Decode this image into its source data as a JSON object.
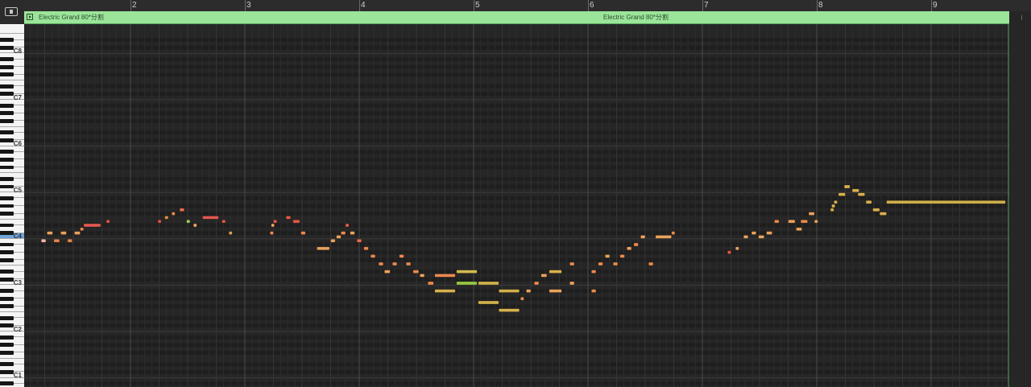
{
  "ruler": {
    "bars": [
      "2",
      "3",
      "4",
      "5",
      "6",
      "7",
      "8",
      "9"
    ]
  },
  "region": {
    "name": "Electric Grand 80*分割",
    "name_repeat": "Electric Grand 80*分割",
    "color": "#9be59a"
  },
  "keyboard": {
    "c_labels": [
      "C8",
      "C7",
      "C6",
      "C5",
      "C4",
      "C3",
      "C2",
      "C1"
    ],
    "highlight_color": "#6fa4d8"
  },
  "notes": [
    {
      "bar": 1.22,
      "len": 0.04,
      "midi": 59,
      "color": "#ffb6a8"
    },
    {
      "bar": 1.27,
      "len": 0.05,
      "midi": 61,
      "color": "#e9a25c"
    },
    {
      "bar": 1.33,
      "len": 0.05,
      "midi": 59,
      "color": "#e5854d"
    },
    {
      "bar": 1.39,
      "len": 0.05,
      "midi": 61,
      "color": "#e9a25c"
    },
    {
      "bar": 1.45,
      "len": 0.04,
      "midi": 59,
      "color": "#e5854d"
    },
    {
      "bar": 1.51,
      "len": 0.05,
      "midi": 61,
      "color": "#e9a25c"
    },
    {
      "bar": 1.56,
      "len": 0.03,
      "midi": 62,
      "color": "#e98a4f"
    },
    {
      "bar": 1.59,
      "len": 0.15,
      "midi": 63,
      "color": "#e0584f"
    },
    {
      "bar": 1.79,
      "len": 0.02,
      "midi": 64,
      "color": "#e05a45"
    },
    {
      "bar": 2.24,
      "len": 0.02,
      "midi": 64,
      "color": "#e05a45"
    },
    {
      "bar": 2.3,
      "len": 0.03,
      "midi": 65,
      "color": "#e98a4f"
    },
    {
      "bar": 2.36,
      "len": 0.03,
      "midi": 66,
      "color": "#e98a4f"
    },
    {
      "bar": 2.43,
      "len": 0.04,
      "midi": 67,
      "color": "#e86f4d"
    },
    {
      "bar": 2.49,
      "len": 0.03,
      "midi": 64,
      "color": "#9fd160"
    },
    {
      "bar": 2.55,
      "len": 0.03,
      "midi": 63,
      "color": "#e9a25c"
    },
    {
      "bar": 2.63,
      "len": 0.14,
      "midi": 65,
      "color": "#e0584f"
    },
    {
      "bar": 2.8,
      "len": 0.03,
      "midi": 64,
      "color": "#e05a45"
    },
    {
      "bar": 2.86,
      "len": 0.03,
      "midi": 61,
      "color": "#d9a24c"
    },
    {
      "bar": 3.22,
      "len": 0.03,
      "midi": 61,
      "color": "#e98a4f"
    },
    {
      "bar": 3.23,
      "len": 0.02,
      "midi": 63,
      "color": "#e9a25c"
    },
    {
      "bar": 3.25,
      "len": 0.03,
      "midi": 64,
      "color": "#e05a45"
    },
    {
      "bar": 3.36,
      "len": 0.04,
      "midi": 65,
      "color": "#e05a45"
    },
    {
      "bar": 3.42,
      "len": 0.06,
      "midi": 64,
      "color": "#e05a45"
    },
    {
      "bar": 3.49,
      "len": 0.04,
      "midi": 61,
      "color": "#e98a4f"
    },
    {
      "bar": 3.63,
      "len": 0.11,
      "midi": 57,
      "color": "#e9a25c"
    },
    {
      "bar": 3.75,
      "len": 0.04,
      "midi": 59,
      "color": "#e9a25c"
    },
    {
      "bar": 3.8,
      "len": 0.04,
      "midi": 60,
      "color": "#e9a25c"
    },
    {
      "bar": 3.84,
      "len": 0.04,
      "midi": 61,
      "color": "#e98a4f"
    },
    {
      "bar": 3.88,
      "len": 0.03,
      "midi": 63,
      "color": "#e0584f"
    },
    {
      "bar": 3.92,
      "len": 0.04,
      "midi": 61,
      "color": "#e9a25c"
    },
    {
      "bar": 3.98,
      "len": 0.04,
      "midi": 59,
      "color": "#e86f4d"
    },
    {
      "bar": 4.04,
      "len": 0.04,
      "midi": 57,
      "color": "#e98a4f"
    },
    {
      "bar": 4.1,
      "len": 0.04,
      "midi": 55,
      "color": "#e98a4f"
    },
    {
      "bar": 4.17,
      "len": 0.04,
      "midi": 53,
      "color": "#e98a4f"
    },
    {
      "bar": 4.22,
      "len": 0.05,
      "midi": 51,
      "color": "#e9a25c"
    },
    {
      "bar": 4.29,
      "len": 0.04,
      "midi": 53,
      "color": "#e98a4f"
    },
    {
      "bar": 4.35,
      "len": 0.04,
      "midi": 55,
      "color": "#e98a4f"
    },
    {
      "bar": 4.41,
      "len": 0.04,
      "midi": 53,
      "color": "#e98a4f"
    },
    {
      "bar": 4.47,
      "len": 0.05,
      "midi": 51,
      "color": "#e98a4f"
    },
    {
      "bar": 4.53,
      "len": 0.04,
      "midi": 50,
      "color": "#e9a25c"
    },
    {
      "bar": 4.6,
      "len": 0.05,
      "midi": 48,
      "color": "#e98a4f"
    },
    {
      "bar": 4.66,
      "len": 0.18,
      "midi": 46,
      "color": "#d7b04e"
    },
    {
      "bar": 4.66,
      "len": 0.18,
      "midi": 50,
      "color": "#e98a4f"
    },
    {
      "bar": 4.85,
      "len": 0.18,
      "midi": 51,
      "color": "#d2bb52"
    },
    {
      "bar": 4.85,
      "len": 0.18,
      "midi": 48,
      "color": "#98c83f"
    },
    {
      "bar": 5.04,
      "len": 0.18,
      "midi": 48,
      "color": "#d0b04a"
    },
    {
      "bar": 5.04,
      "len": 0.18,
      "midi": 43,
      "color": "#d0b04a"
    },
    {
      "bar": 5.22,
      "len": 0.18,
      "midi": 46,
      "color": "#d0b04a"
    },
    {
      "bar": 5.22,
      "len": 0.18,
      "midi": 41,
      "color": "#d7b04e"
    },
    {
      "bar": 5.41,
      "len": 0.03,
      "midi": 44,
      "color": "#e98a4f"
    },
    {
      "bar": 5.46,
      "len": 0.04,
      "midi": 46,
      "color": "#e9a25c"
    },
    {
      "bar": 5.53,
      "len": 0.04,
      "midi": 48,
      "color": "#e98a4f"
    },
    {
      "bar": 5.59,
      "len": 0.05,
      "midi": 50,
      "color": "#e9a25c"
    },
    {
      "bar": 5.66,
      "len": 0.11,
      "midi": 51,
      "color": "#d7b04e"
    },
    {
      "bar": 5.66,
      "len": 0.11,
      "midi": 46,
      "color": "#e9a25c"
    },
    {
      "bar": 5.84,
      "len": 0.04,
      "midi": 48,
      "color": "#e9a25c"
    },
    {
      "bar": 5.84,
      "len": 0.04,
      "midi": 53,
      "color": "#e98a4f"
    },
    {
      "bar": 6.03,
      "len": 0.04,
      "midi": 51,
      "color": "#e98a4f"
    },
    {
      "bar": 6.03,
      "len": 0.04,
      "midi": 46,
      "color": "#e98a4f"
    },
    {
      "bar": 6.09,
      "len": 0.04,
      "midi": 53,
      "color": "#e98a4f"
    },
    {
      "bar": 6.15,
      "len": 0.04,
      "midi": 55,
      "color": "#e9a25c"
    },
    {
      "bar": 6.22,
      "len": 0.04,
      "midi": 53,
      "color": "#e98a4f"
    },
    {
      "bar": 6.28,
      "len": 0.04,
      "midi": 55,
      "color": "#e98a4f"
    },
    {
      "bar": 6.34,
      "len": 0.04,
      "midi": 57,
      "color": "#e9a25c"
    },
    {
      "bar": 6.4,
      "len": 0.04,
      "midi": 58,
      "color": "#e98a4f"
    },
    {
      "bar": 6.46,
      "len": 0.04,
      "midi": 60,
      "color": "#e9a25c"
    },
    {
      "bar": 6.53,
      "len": 0.04,
      "midi": 53,
      "color": "#e98a4f"
    },
    {
      "bar": 6.59,
      "len": 0.14,
      "midi": 60,
      "color": "#e9a25c"
    },
    {
      "bar": 6.73,
      "len": 0.03,
      "midi": 61,
      "color": "#e98a4f"
    },
    {
      "bar": 7.22,
      "len": 0.03,
      "midi": 56,
      "color": "#e05a45"
    },
    {
      "bar": 7.29,
      "len": 0.03,
      "midi": 57,
      "color": "#e9a25c"
    },
    {
      "bar": 7.36,
      "len": 0.04,
      "midi": 60,
      "color": "#e9a25c"
    },
    {
      "bar": 7.43,
      "len": 0.04,
      "midi": 61,
      "color": "#e9a25c"
    },
    {
      "bar": 7.49,
      "len": 0.05,
      "midi": 60,
      "color": "#e9a25c"
    },
    {
      "bar": 7.56,
      "len": 0.05,
      "midi": 61,
      "color": "#e9a25c"
    },
    {
      "bar": 7.63,
      "len": 0.04,
      "midi": 64,
      "color": "#e98a4f"
    },
    {
      "bar": 7.75,
      "len": 0.06,
      "midi": 64,
      "color": "#e9a25c"
    },
    {
      "bar": 7.82,
      "len": 0.05,
      "midi": 62,
      "color": "#e9a25c"
    },
    {
      "bar": 7.86,
      "len": 0.06,
      "midi": 64,
      "color": "#e98a4f"
    },
    {
      "bar": 7.93,
      "len": 0.05,
      "midi": 66,
      "color": "#e9a25c"
    },
    {
      "bar": 7.98,
      "len": 0.03,
      "midi": 64,
      "color": "#e9a25c"
    },
    {
      "bar": 8.12,
      "len": 0.03,
      "midi": 67,
      "color": "#d7b04e"
    },
    {
      "bar": 8.13,
      "len": 0.03,
      "midi": 68,
      "color": "#d7b04e"
    },
    {
      "bar": 8.15,
      "len": 0.03,
      "midi": 69,
      "color": "#d7b04e"
    },
    {
      "bar": 8.19,
      "len": 0.06,
      "midi": 71,
      "color": "#d7b04e"
    },
    {
      "bar": 8.24,
      "len": 0.05,
      "midi": 73,
      "color": "#d7b04e"
    },
    {
      "bar": 8.31,
      "len": 0.06,
      "midi": 72,
      "color": "#d7b04e"
    },
    {
      "bar": 8.36,
      "len": 0.06,
      "midi": 71,
      "color": "#d7b04e"
    },
    {
      "bar": 8.43,
      "len": 0.05,
      "midi": 69,
      "color": "#d7b04e"
    },
    {
      "bar": 8.49,
      "len": 0.06,
      "midi": 67,
      "color": "#d7b04e"
    },
    {
      "bar": 8.55,
      "len": 0.06,
      "midi": 66,
      "color": "#d7b04e"
    },
    {
      "bar": 8.61,
      "len": 1.04,
      "midi": 69,
      "color": "#d0b04a"
    }
  ]
}
